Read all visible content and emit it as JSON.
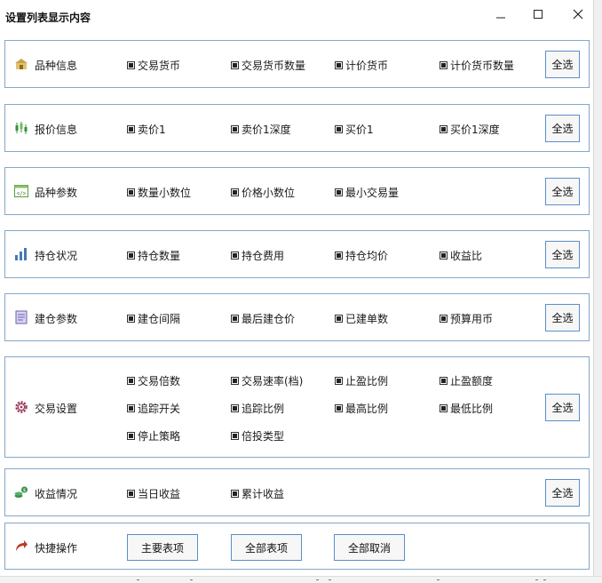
{
  "window": {
    "title": "设置列表显示内容",
    "minimize_glyph": "—",
    "maximize_glyph": "☐",
    "close_glyph": "✕"
  },
  "select_all_label": "全选",
  "groups": [
    {
      "key": "variety",
      "label": "品种信息",
      "icon": "building-icon",
      "rows": [
        [
          "交易货币",
          "交易货币数量",
          "计价货币",
          "计价货币数量"
        ]
      ]
    },
    {
      "key": "quote",
      "label": "报价信息",
      "icon": "candlestick-icon",
      "rows": [
        [
          "卖价1",
          "卖价1深度",
          "买价1",
          "买价1深度"
        ]
      ]
    },
    {
      "key": "params",
      "label": "品种参数",
      "icon": "code-window-icon",
      "rows": [
        [
          "数量小数位",
          "价格小数位",
          "最小交易量"
        ]
      ]
    },
    {
      "key": "position",
      "label": "持仓状况",
      "icon": "bar-chart-icon",
      "rows": [
        [
          "持仓数量",
          "持仓费用",
          "持仓均价",
          "收益比"
        ]
      ]
    },
    {
      "key": "build",
      "label": "建仓参数",
      "icon": "notepad-icon",
      "rows": [
        [
          "建仓间隔",
          "最后建仓价",
          "已建单数",
          "预算用币"
        ]
      ]
    },
    {
      "key": "trade",
      "label": "交易设置",
      "icon": "gear-icon",
      "rows": [
        [
          "交易倍数",
          "交易速率(档)",
          "止盈比例",
          "止盈额度"
        ],
        [
          "追踪开关",
          "追踪比例",
          "最高比例",
          "最低比例"
        ],
        [
          "停止策略",
          "倍投类型"
        ]
      ]
    },
    {
      "key": "income",
      "label": "收益情况",
      "icon": "coins-icon",
      "rows": [
        [
          "当日收益",
          "累计收益"
        ]
      ]
    }
  ],
  "quick": {
    "label": "快捷操作",
    "icon": "forward-arrow-icon",
    "buttons": [
      "主要表项",
      "全部表项",
      "全部取消"
    ]
  }
}
